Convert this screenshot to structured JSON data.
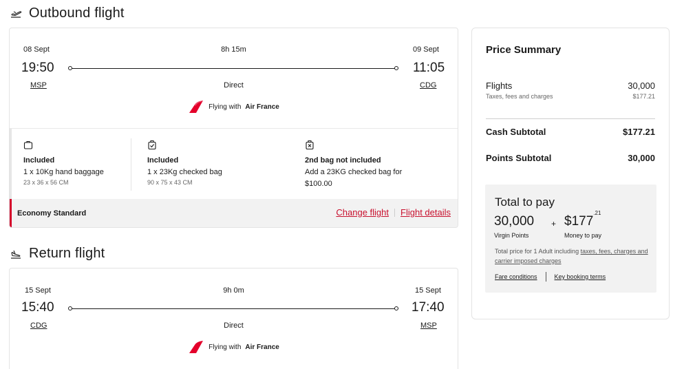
{
  "outbound": {
    "heading": "Outbound flight",
    "depart_date": "08 Sept",
    "depart_time": "19:50",
    "depart_airport": "MSP",
    "arrive_date": "09 Sept",
    "arrive_time": "11:05",
    "arrive_airport": "CDG",
    "duration": "8h 15m",
    "stops": "Direct",
    "airline_prefix": "Flying with",
    "airline_name": "Air France",
    "bags": [
      {
        "icon": "hand-bag-icon",
        "title": "Included",
        "line": "1 x 10Kg hand baggage",
        "dims": "23 x 36 x 56 CM"
      },
      {
        "icon": "checked-bag-icon",
        "title": "Included",
        "line": "1 x 23Kg checked bag",
        "dims": "90 x 75 x 43 CM"
      },
      {
        "icon": "bag-not-included-icon",
        "title": "2nd bag not included",
        "line": "Add a 23KG checked bag for",
        "dims": "$100.00"
      }
    ],
    "fare_name": "Economy Standard",
    "change_flight": "Change flight",
    "flight_details": "Flight details"
  },
  "return": {
    "heading": "Return flight",
    "depart_date": "15 Sept",
    "depart_time": "15:40",
    "depart_airport": "CDG",
    "arrive_date": "15 Sept",
    "arrive_time": "17:40",
    "arrive_airport": "MSP",
    "duration": "9h 0m",
    "stops": "Direct",
    "airline_prefix": "Flying with",
    "airline_name": "Air France"
  },
  "summary": {
    "title": "Price Summary",
    "flights_label": "Flights",
    "flights_value": "30,000",
    "taxes_label": "Taxes, fees and charges",
    "taxes_value": "$177.21",
    "cash_label": "Cash Subtotal",
    "cash_value": "$177.21",
    "points_label": "Points Subtotal",
    "points_value": "30,000",
    "pay": {
      "title": "Total to pay",
      "points_amount": "30,000",
      "points_label": "Virgin Points",
      "plus": "+",
      "money_main": "$177",
      "money_cents": ".21",
      "money_label": "Money to pay",
      "note_prefix": "Total price for 1 Adult including",
      "note_link": "taxes, fees, charges and carrier imposed charges",
      "fare_conditions": "Fare conditions",
      "key_terms": "Key booking terms"
    }
  },
  "colors": {
    "accent_red": "#c8102e",
    "panel_grey": "#f2f2f2"
  }
}
